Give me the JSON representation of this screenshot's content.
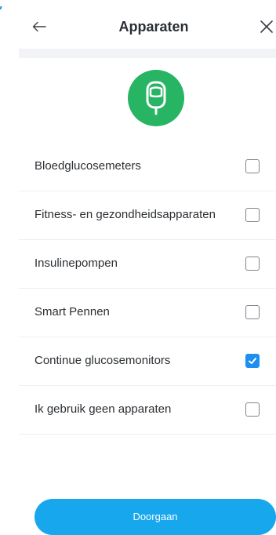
{
  "header": {
    "title": "Apparaten",
    "back_icon": "arrow-left-icon",
    "close_icon": "close-icon"
  },
  "hero_icon": "glucose-meter-icon",
  "devices": [
    {
      "label": "Bloedglucosemeters",
      "checked": false
    },
    {
      "label": "Fitness- en gezondheidsapparaten",
      "checked": false
    },
    {
      "label": "Insulinepompen",
      "checked": false
    },
    {
      "label": "Smart Pennen",
      "checked": false
    },
    {
      "label": "Continue glucosemonitors",
      "checked": true
    },
    {
      "label": "Ik gebruik geen apparaten",
      "checked": false
    }
  ],
  "footer": {
    "continue_label": "Doorgaan"
  },
  "colors": {
    "accent_green": "#27b463",
    "checkbox_checked": "#1d8ff0",
    "button_blue": "#17a7ec"
  }
}
